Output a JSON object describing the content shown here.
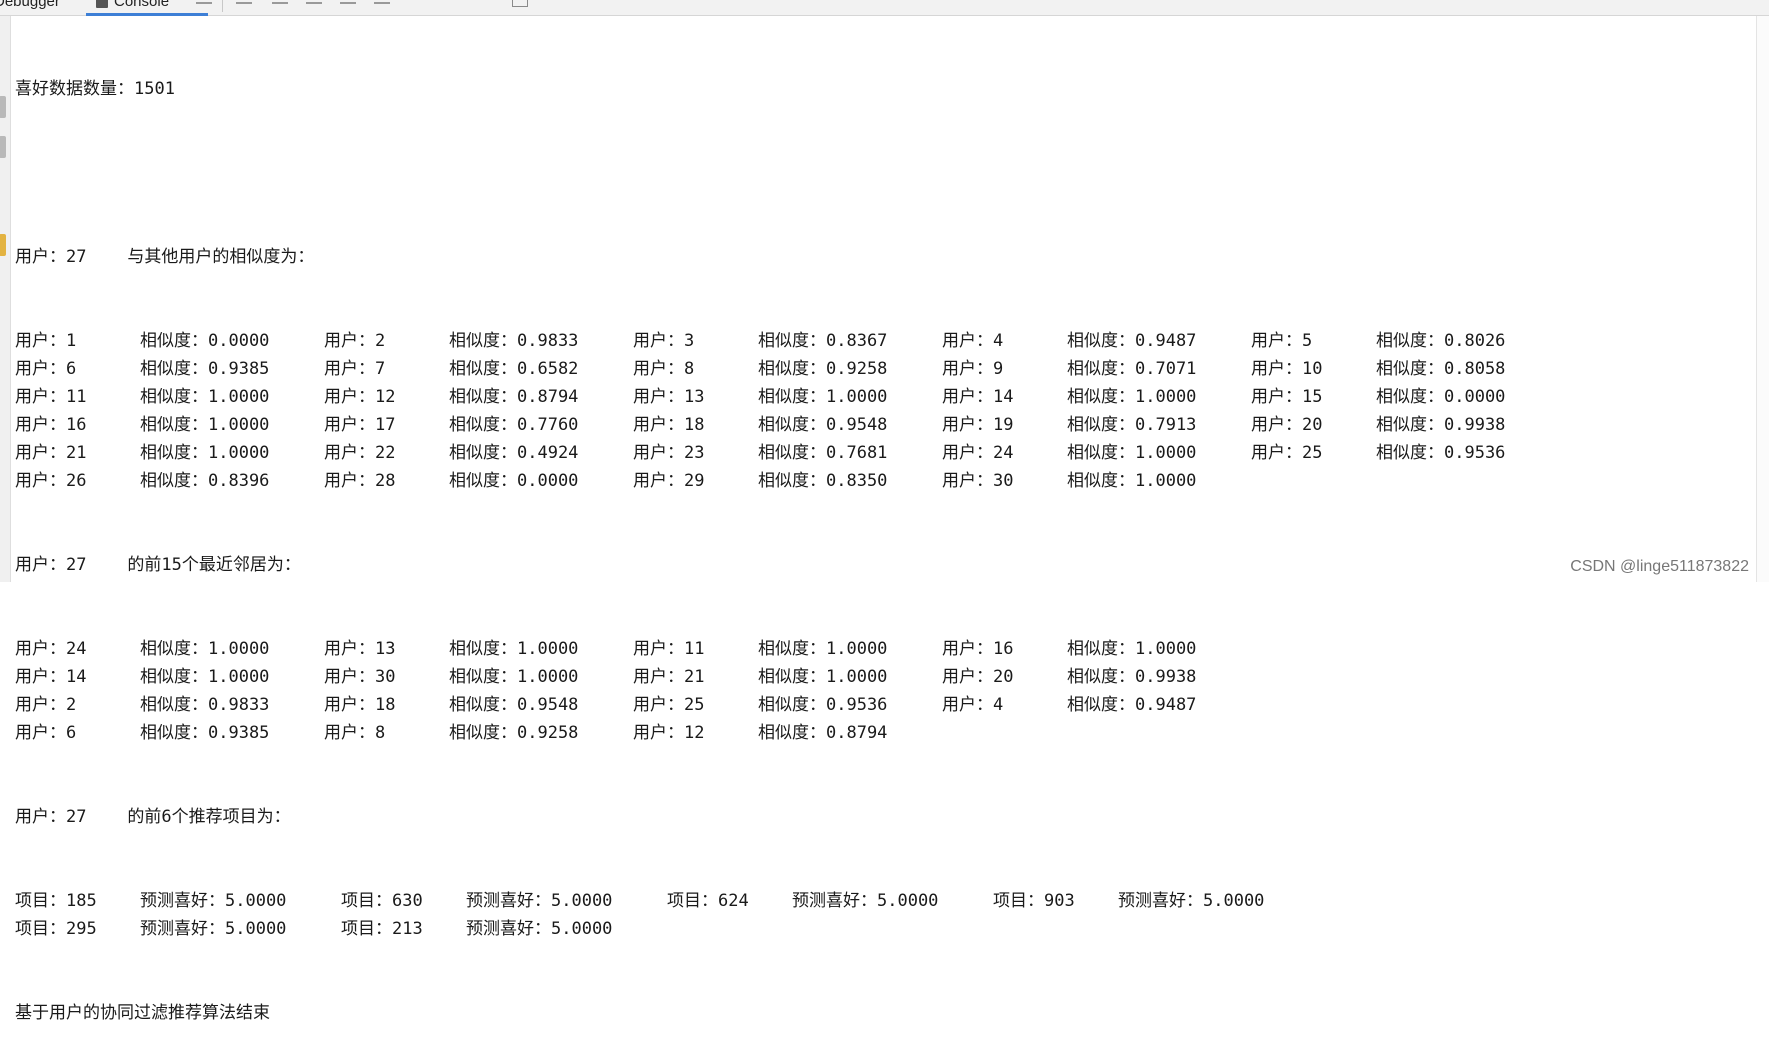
{
  "tabs": {
    "debugger": "Debugger",
    "console": "Console"
  },
  "console": {
    "count_line": "喜好数据数量：1501",
    "sim_header": "用户：27    与其他用户的相似度为：",
    "sim_rows": [
      [
        "用户：1",
        "相似度：0.0000",
        "用户：2",
        "相似度：0.9833",
        "用户：3",
        "相似度：0.8367",
        "用户：4",
        "相似度：0.9487",
        "用户：5",
        "相似度：0.8026"
      ],
      [
        "用户：6",
        "相似度：0.9385",
        "用户：7",
        "相似度：0.6582",
        "用户：8",
        "相似度：0.9258",
        "用户：9",
        "相似度：0.7071",
        "用户：10",
        "相似度：0.8058"
      ],
      [
        "用户：11",
        "相似度：1.0000",
        "用户：12",
        "相似度：0.8794",
        "用户：13",
        "相似度：1.0000",
        "用户：14",
        "相似度：1.0000",
        "用户：15",
        "相似度：0.0000"
      ],
      [
        "用户：16",
        "相似度：1.0000",
        "用户：17",
        "相似度：0.7760",
        "用户：18",
        "相似度：0.9548",
        "用户：19",
        "相似度：0.7913",
        "用户：20",
        "相似度：0.9938"
      ],
      [
        "用户：21",
        "相似度：1.0000",
        "用户：22",
        "相似度：0.4924",
        "用户：23",
        "相似度：0.7681",
        "用户：24",
        "相似度：1.0000",
        "用户：25",
        "相似度：0.9536"
      ],
      [
        "用户：26",
        "相似度：0.8396",
        "用户：28",
        "相似度：0.0000",
        "用户：29",
        "相似度：0.8350",
        "用户：30",
        "相似度：1.0000"
      ]
    ],
    "neighbor_header": "用户：27    的前15个最近邻居为：",
    "neighbor_rows": [
      [
        "用户：24",
        "相似度：1.0000",
        "用户：13",
        "相似度：1.0000",
        "用户：11",
        "相似度：1.0000",
        "用户：16",
        "相似度：1.0000"
      ],
      [
        "用户：14",
        "相似度：1.0000",
        "用户：30",
        "相似度：1.0000",
        "用户：21",
        "相似度：1.0000",
        "用户：20",
        "相似度：0.9938"
      ],
      [
        "用户：2",
        "相似度：0.9833",
        "用户：18",
        "相似度：0.9548",
        "用户：25",
        "相似度：0.9536",
        "用户：4",
        "相似度：0.9487"
      ],
      [
        "用户：6",
        "相似度：0.9385",
        "用户：8",
        "相似度：0.9258",
        "用户：12",
        "相似度：0.8794"
      ]
    ],
    "rec_header": "用户：27    的前6个推荐项目为：",
    "rec_rows": [
      [
        "项目：185",
        "预测喜好：5.0000",
        "项目：630",
        "预测喜好：5.0000",
        "项目：624",
        "预测喜好：5.0000",
        "项目：903",
        "预测喜好：5.0000"
      ],
      [
        "项目：295",
        "预测喜好：5.0000",
        "项目：213",
        "预测喜好：5.0000"
      ]
    ],
    "end_line": "基于用户的协同过滤推荐算法结束"
  },
  "watermark": "CSDN @linge511873822"
}
